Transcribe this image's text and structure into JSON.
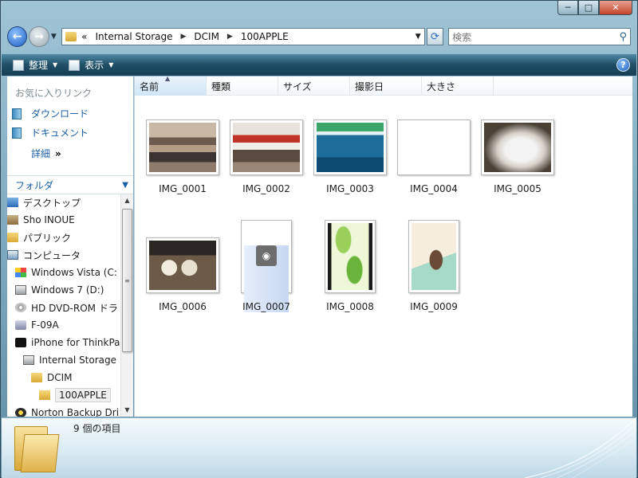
{
  "window": {
    "caption_buttons": [
      "─",
      "□",
      "✕"
    ]
  },
  "address": {
    "overflow": "«",
    "crumbs": [
      "Internal Storage",
      "DCIM",
      "100APPLE"
    ],
    "search_placeholder": "検索"
  },
  "toolbar": {
    "organize": "整理",
    "view": "表示",
    "help": "?"
  },
  "favorites": {
    "title": "お気に入りリンク",
    "items": [
      "ダウンロード",
      "ドキュメント"
    ],
    "more": "詳細",
    "more_arrow": "»"
  },
  "folders": {
    "title": "フォルダ",
    "tree": [
      {
        "label": "デスクトップ",
        "icon": "desktop-icon"
      },
      {
        "label": "Sho INOUE",
        "icon": "user-folder-icon"
      },
      {
        "label": "パブリック",
        "icon": "folder-icon"
      },
      {
        "label": "コンピュータ",
        "icon": "computer-icon"
      },
      {
        "label": "Windows Vista (C:",
        "icon": "windows-drive-icon"
      },
      {
        "label": "Windows 7 (D:)",
        "icon": "drive-icon"
      },
      {
        "label": "HD DVD-ROM ドラ",
        "icon": "dvd-drive-icon"
      },
      {
        "label": "F-09A",
        "icon": "phone-icon"
      },
      {
        "label": "iPhone for ThinkPa",
        "icon": "iphone-icon"
      },
      {
        "label": "Internal Storage",
        "icon": "drive-icon"
      },
      {
        "label": "DCIM",
        "icon": "folder-icon"
      },
      {
        "label": "100APPLE",
        "icon": "folder-icon",
        "selected": true
      },
      {
        "label": "Norton Backup Dri",
        "icon": "norton-icon"
      }
    ]
  },
  "columns": [
    "名前",
    "種類",
    "サイズ",
    "撮影日",
    "大きさ"
  ],
  "files": [
    {
      "name": "IMG_0001",
      "orient": "landscape",
      "style": "crowd"
    },
    {
      "name": "IMG_0002",
      "orient": "landscape",
      "style": "store"
    },
    {
      "name": "IMG_0003",
      "orient": "landscape",
      "style": "blue"
    },
    {
      "name": "IMG_0004",
      "orient": "landscape",
      "style": "crossing"
    },
    {
      "name": "IMG_0005",
      "orient": "landscape",
      "style": "bag"
    },
    {
      "name": "IMG_0006",
      "orient": "landscape",
      "style": "food"
    },
    {
      "name": "IMG_0007",
      "orient": "portrait",
      "style": "screen"
    },
    {
      "name": "IMG_0008",
      "orient": "portrait",
      "style": "leaves"
    },
    {
      "name": "IMG_0009",
      "orient": "portrait",
      "style": "anime"
    }
  ],
  "status": {
    "count": "9 個の項目"
  }
}
